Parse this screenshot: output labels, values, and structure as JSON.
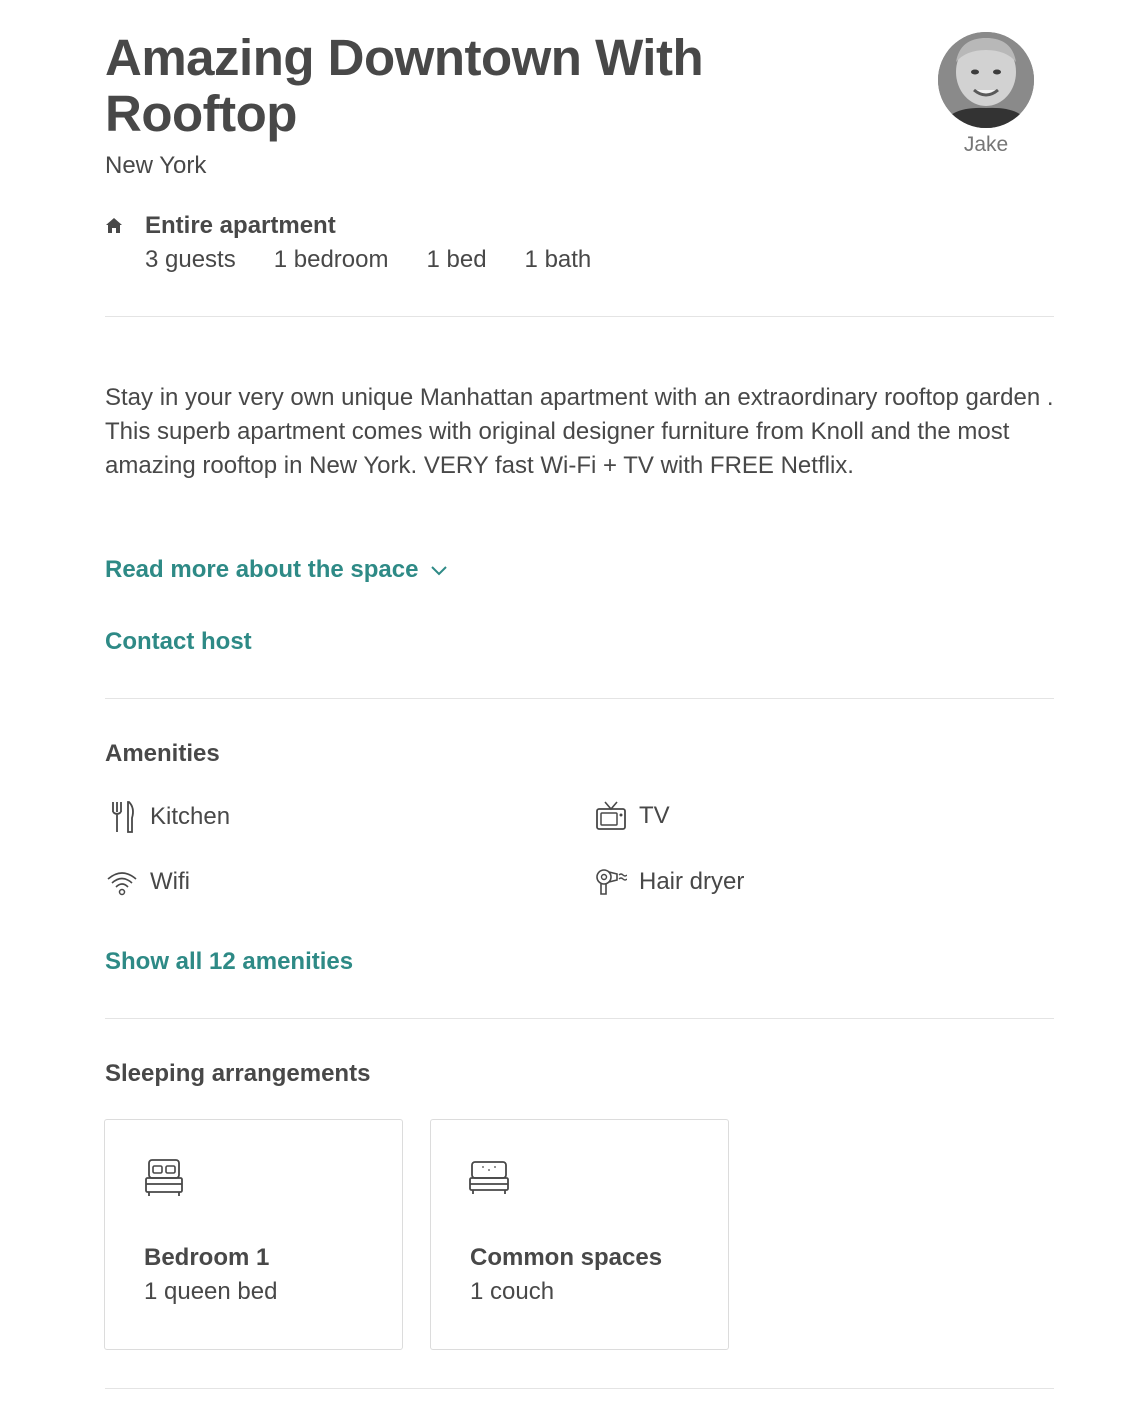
{
  "listing": {
    "title": "Amazing Downtown With Rooftop",
    "location": "New York",
    "property_type": "Entire apartment",
    "stats": [
      "3 guests",
      "1 bedroom",
      "1 bed",
      "1 bath"
    ]
  },
  "host": {
    "name": "Jake"
  },
  "description": {
    "text": "Stay in your very own unique Manhattan apartment with an extraordinary rooftop garden . This superb apartment comes with original designer furniture from Knoll and the most amazing rooftop in New York. VERY fast Wi-Fi + TV with FREE Netflix.",
    "read_more_label": "Read more about the space",
    "contact_label": "Contact host"
  },
  "amenities": {
    "title": "Amenities",
    "items": [
      {
        "label": "Kitchen",
        "icon": "kitchen-icon"
      },
      {
        "label": "TV",
        "icon": "tv-icon"
      },
      {
        "label": "Wifi",
        "icon": "wifi-icon"
      },
      {
        "label": "Hair dryer",
        "icon": "hair-dryer-icon"
      }
    ],
    "show_all_label": "Show all 12 amenities"
  },
  "sleeping": {
    "title": "Sleeping arrangements",
    "rooms": [
      {
        "name": "Bedroom 1",
        "beds": "1 queen bed",
        "icon": "bed-icon"
      },
      {
        "name": "Common spaces",
        "beds": "1 couch",
        "icon": "couch-icon"
      }
    ]
  },
  "colors": {
    "accent": "#2e8a86",
    "text": "#484848",
    "divider": "#e4e4e4"
  }
}
